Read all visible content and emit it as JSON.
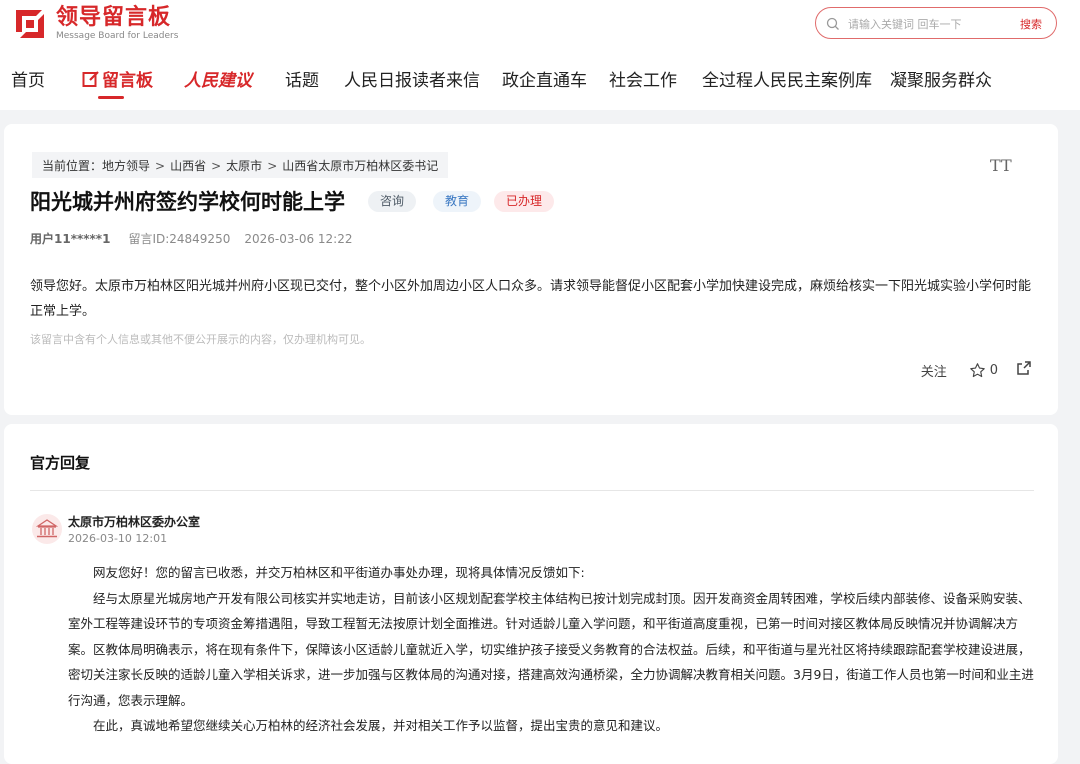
{
  "header": {
    "logo_title": "领导留言板",
    "logo_sub": "Message Board for Leaders",
    "search_placeholder": "请输入关键词 回车一下",
    "search_button": "搜索"
  },
  "nav": {
    "items": [
      "首页",
      "留言板",
      "人民建议",
      "话题",
      "人民日报读者来信",
      "政企直通车",
      "社会工作",
      "全过程人民民主案例库",
      "凝聚服务群众"
    ]
  },
  "message": {
    "breadcrumb": [
      "当前位置：",
      "地方领导",
      "山西省",
      "太原市",
      "山西省太原市万柏林区委书记"
    ],
    "breadcrumb_sep": ">",
    "font_toggle": "TT",
    "title": "阳光城并州府签约学校何时能上学",
    "tags": [
      "咨询",
      "教育",
      "已办理"
    ],
    "user": "用户11*****1",
    "message_id": "留言ID:24849250",
    "datetime": "2026-03-06 12:22",
    "content": "领导您好。太原市万柏林区阳光城并州府小区现已交付，整个小区外加周边小区人口众多。请求领导能督促小区配套小学加快建设完成，麻烦给核实一下阳光城实验小学何时能正常上学。",
    "notice": "该留言中含有个人信息或其他不便公开展示的内容，仅办理机构可见。",
    "follow_label": "关注",
    "like_count": "0"
  },
  "reply": {
    "heading": "官方回复",
    "org_name": "太原市万柏林区委办公室",
    "org_date": "2026-03-10 12:01",
    "paragraphs": [
      "网友您好！您的留言已收悉，并交万柏林区和平街道办事处办理，现将具体情况反馈如下:",
      "经与太原星光城房地产开发有限公司核实并实地走访，目前该小区规划配套学校主体结构已按计划完成封顶。因开发商资金周转困难，学校后续内部装修、设备采购安装、室外工程等建设环节的专项资金筹措遇阻，导致工程暂无法按原计划全面推进。针对适龄儿童入学问题，和平街道高度重视，已第一时间对接区教体局反映情况并协调解决方案。区教体局明确表示，将在现有条件下，保障该小区适龄儿童就近入学，切实维护孩子接受义务教育的合法权益。后续，和平街道与星光社区将持续跟踪配套学校建设进展，密切关注家长反映的适龄儿童入学相关诉求，进一步加强与区教体局的沟通对接，搭建高效沟通桥梁，全力协调解决教育相关问题。3月9日，街道工作人员也第一时间和业主进行沟通，您表示理解。",
      "在此，真诚地希望您继续关心万柏林的经济社会发展，并对相关工作予以监督，提出宝贵的意见和建议。"
    ]
  },
  "colors": {
    "brand_red": "#d7282a",
    "tag_blue": "#3a78c2",
    "page_bg": "#f2f3f5"
  }
}
